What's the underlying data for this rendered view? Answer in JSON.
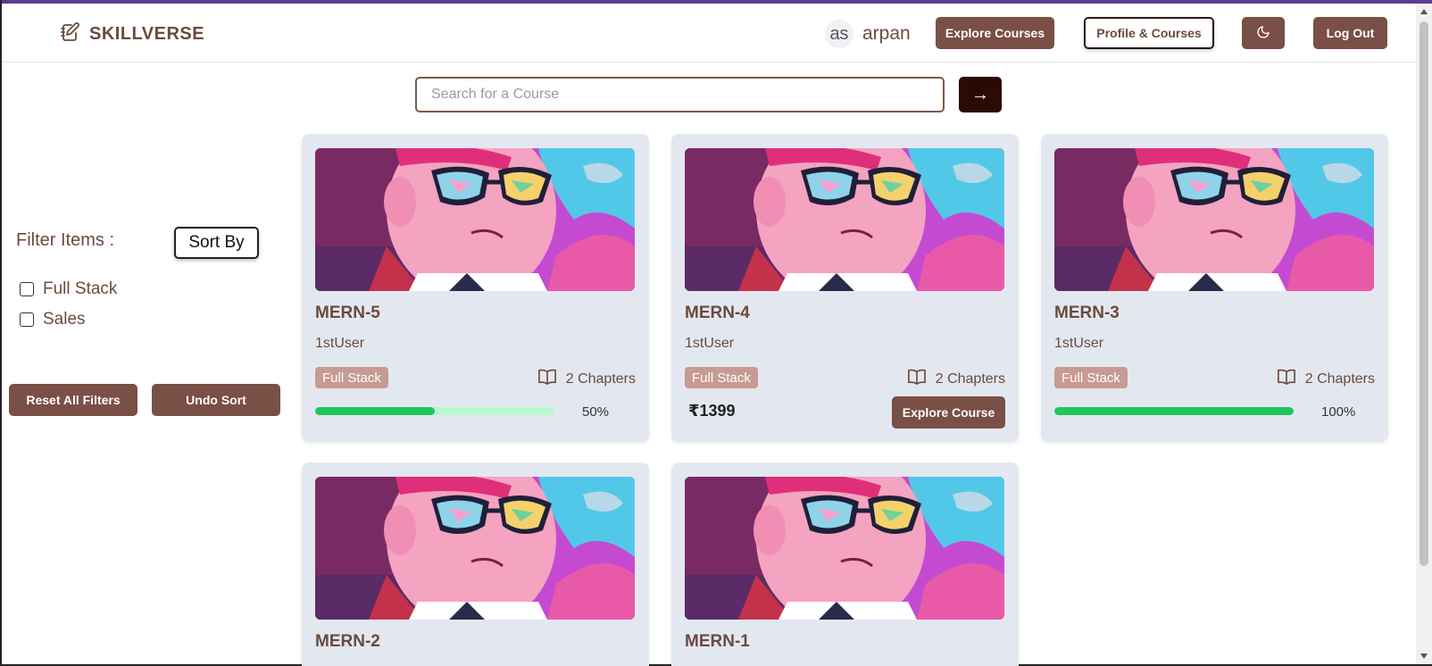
{
  "header": {
    "brand": "SKILLVERSE",
    "user": {
      "initials": "as",
      "name": "arpan"
    },
    "explore_label": "Explore Courses",
    "profile_label": "Profile & Courses",
    "logout_label": "Log Out"
  },
  "search": {
    "placeholder": "Search for a Course",
    "button": "→"
  },
  "sidebar": {
    "filter_title": "Filter Items :",
    "sort_label": "Sort By",
    "filters": [
      "Full Stack",
      "Sales"
    ],
    "reset_label": "Reset All Filters",
    "undo_label": "Undo Sort"
  },
  "colors": {
    "accent": "#7a4f45",
    "progress": "#22c55e",
    "progress_track": "#bbf7d0",
    "tag": "#c79a93",
    "card_bg": "#e3e8f0"
  },
  "courses": [
    {
      "title": "MERN-5",
      "author": "1stUser",
      "tag": "Full Stack",
      "chapters": "2 Chapters",
      "progress": 50,
      "progress_label": "50%"
    },
    {
      "title": "MERN-4",
      "author": "1stUser",
      "tag": "Full Stack",
      "chapters": "2 Chapters",
      "price": "₹1399",
      "action": "Explore Course"
    },
    {
      "title": "MERN-3",
      "author": "1stUser",
      "tag": "Full Stack",
      "chapters": "2 Chapters",
      "progress": 100,
      "progress_label": "100%"
    },
    {
      "title": "MERN-2"
    },
    {
      "title": "MERN-1"
    }
  ]
}
